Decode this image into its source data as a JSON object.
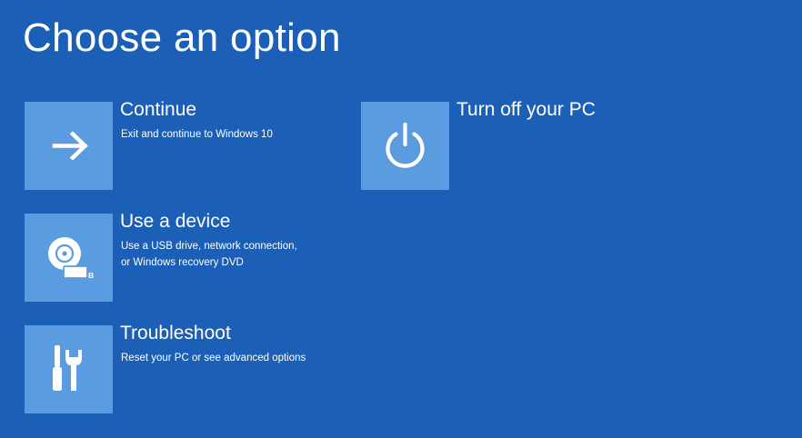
{
  "page": {
    "title": "Choose an option"
  },
  "options": [
    {
      "title": "Continue",
      "description": [
        "Exit and continue to Windows 10"
      ],
      "icon": "arrow-right-icon"
    },
    {
      "title": "Use a device",
      "description": [
        "Use a USB drive, network connection,",
        "or Windows recovery DVD"
      ],
      "icon": "disc-usb-icon"
    },
    {
      "title": "Troubleshoot",
      "description": [
        "Reset your PC or see advanced options"
      ],
      "icon": "tools-icon"
    },
    {
      "title": "Turn off your PC",
      "description": [],
      "icon": "power-icon"
    }
  ],
  "colors": {
    "background": "#1c5fb6",
    "tile": "#5b9ce1",
    "text": "#ffffff"
  }
}
